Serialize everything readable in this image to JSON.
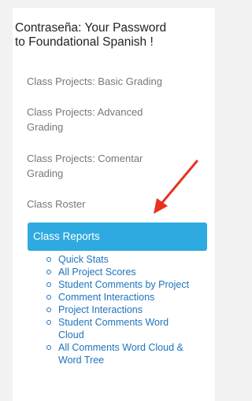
{
  "course": {
    "title_line1": "Contraseña: Your Password",
    "title_line2": "to Foundational Spanish !"
  },
  "nav": {
    "items": [
      {
        "label": "Class Projects: Basic Grading"
      },
      {
        "label_line1": "Class Projects: Advanced",
        "label_line2": "Grading"
      },
      {
        "label_line1": "Class Projects: Comentar",
        "label_line2": "Grading"
      },
      {
        "label": "Class Roster"
      }
    ],
    "active": {
      "label": "Class Reports"
    },
    "sub_items": [
      {
        "label": "Quick Stats"
      },
      {
        "label": "All Project Scores"
      },
      {
        "label": "Student Comments by Project"
      },
      {
        "label": "Comment Interactions"
      },
      {
        "label": "Project Interactions"
      },
      {
        "label_line1": "Student Comments Word",
        "label_line2": "Cloud"
      },
      {
        "label_line1": "All Comments Word Cloud &",
        "label_line2": "Word Tree"
      }
    ]
  },
  "colors": {
    "accent": "#2eaae0",
    "link": "#1e73be",
    "arrow": "#e8321f"
  }
}
